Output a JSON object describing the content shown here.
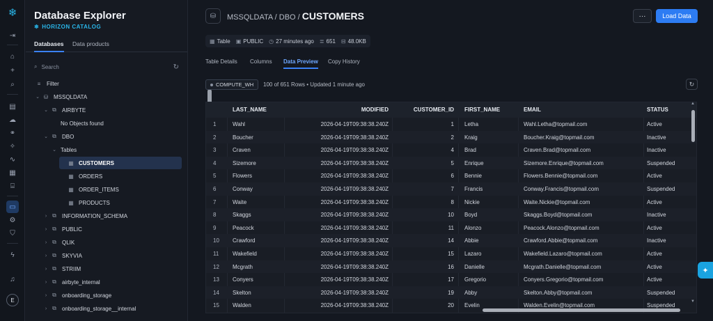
{
  "sidebar": {
    "title": "Database Explorer",
    "subtitle": "HORIZON CATALOG",
    "tabs": [
      "Databases",
      "Data products"
    ],
    "search_placeholder": "Search",
    "filter_label": "Filter",
    "tree": [
      {
        "label": "MSSQLDATA",
        "depth": 0,
        "icon": "database-icon",
        "expanded": true
      },
      {
        "label": "AIRBYTE",
        "depth": 1,
        "icon": "schema-icon",
        "expanded": true
      },
      {
        "label": "No Objects found",
        "depth": 2,
        "icon": "",
        "expanded": null
      },
      {
        "label": "DBO",
        "depth": 1,
        "icon": "schema-icon",
        "expanded": true
      },
      {
        "label": "Tables",
        "depth": 2,
        "icon": "",
        "expanded": true
      },
      {
        "label": "CUSTOMERS",
        "depth": 3,
        "icon": "table-icon",
        "expanded": null,
        "selected": true
      },
      {
        "label": "ORDERS",
        "depth": 3,
        "icon": "table-icon",
        "expanded": null
      },
      {
        "label": "ORDER_ITEMS",
        "depth": 3,
        "icon": "table-icon",
        "expanded": null
      },
      {
        "label": "PRODUCTS",
        "depth": 3,
        "icon": "table-icon",
        "expanded": null
      },
      {
        "label": "INFORMATION_SCHEMA",
        "depth": 1,
        "icon": "schema-icon",
        "expanded": false
      },
      {
        "label": "PUBLIC",
        "depth": 1,
        "icon": "schema-icon",
        "expanded": false
      },
      {
        "label": "QLIK",
        "depth": 1,
        "icon": "schema-icon",
        "expanded": false
      },
      {
        "label": "SKYVIA",
        "depth": 1,
        "icon": "schema-icon",
        "expanded": false
      },
      {
        "label": "STRIIM",
        "depth": 1,
        "icon": "schema-icon",
        "expanded": false
      },
      {
        "label": "airbyte_internal",
        "depth": 1,
        "icon": "schema-icon",
        "expanded": false
      },
      {
        "label": "onboarding_storage",
        "depth": 1,
        "icon": "schema-icon",
        "expanded": false
      },
      {
        "label": "onboarding_storage__internal",
        "depth": 1,
        "icon": "schema-icon",
        "expanded": false
      }
    ]
  },
  "rail": {
    "avatar_initial": "E"
  },
  "header": {
    "crumb_prefix": "MSSQLDATA / DBO /",
    "crumb_current": "CUSTOMERS",
    "more_label": "···",
    "load_label": "Load Data"
  },
  "meta": {
    "type": "Table",
    "schema": "PUBLIC",
    "modified": "27 minutes ago",
    "rows": "651",
    "size": "48.0KB"
  },
  "tabs": [
    "Table Details",
    "Columns",
    "Data Preview",
    "Copy History"
  ],
  "preview": {
    "warehouse": "COMPUTE_WH",
    "rows_info": "100 of 651 Rows • Updated 1 minute ago"
  },
  "table": {
    "columns": [
      "",
      "LAST_NAME",
      "MODIFIED",
      "CUSTOMER_ID",
      "FIRST_NAME",
      "EMAIL",
      "STATUS"
    ],
    "rows": [
      [
        "1",
        "Wahl",
        "2026-04-19T09:38:38.240Z",
        "1",
        "Letha",
        "Wahl.Letha@topmail.com",
        "Active"
      ],
      [
        "2",
        "Boucher",
        "2026-04-19T09:38:38.240Z",
        "2",
        "Kraig",
        "Boucher.Kraig@topmail.com",
        "Inactive"
      ],
      [
        "3",
        "Craven",
        "2026-04-19T09:38:38.240Z",
        "4",
        "Brad",
        "Craven.Brad@topmail.com",
        "Inactive"
      ],
      [
        "4",
        "Sizemore",
        "2026-04-19T09:38:38.240Z",
        "5",
        "Enrique",
        "Sizemore.Enrique@topmail.com",
        "Suspended"
      ],
      [
        "5",
        "Flowers",
        "2026-04-19T09:38:38.240Z",
        "6",
        "Bennie",
        "Flowers.Bennie@topmail.com",
        "Active"
      ],
      [
        "6",
        "Conway",
        "2026-04-19T09:38:38.240Z",
        "7",
        "Francis",
        "Conway.Francis@topmail.com",
        "Suspended"
      ],
      [
        "7",
        "Waite",
        "2026-04-19T09:38:38.240Z",
        "8",
        "Nickie",
        "Waite.Nickie@topmail.com",
        "Active"
      ],
      [
        "8",
        "Skaggs",
        "2026-04-19T09:38:38.240Z",
        "10",
        "Boyd",
        "Skaggs.Boyd@topmail.com",
        "Inactive"
      ],
      [
        "9",
        "Peacock",
        "2026-04-19T09:38:38.240Z",
        "11",
        "Alonzo",
        "Peacock.Alonzo@topmail.com",
        "Active"
      ],
      [
        "10",
        "Crawford",
        "2026-04-19T09:38:38.240Z",
        "14",
        "Abbie",
        "Crawford.Abbie@topmail.com",
        "Inactive"
      ],
      [
        "11",
        "Wakefield",
        "2026-04-19T09:38:38.240Z",
        "15",
        "Lazaro",
        "Wakefield.Lazaro@topmail.com",
        "Active"
      ],
      [
        "12",
        "Mcgrath",
        "2026-04-19T09:38:38.240Z",
        "16",
        "Danielle",
        "Mcgrath.Danielle@topmail.com",
        "Active"
      ],
      [
        "13",
        "Conyers",
        "2026-04-19T09:38:38.240Z",
        "17",
        "Gregorio",
        "Conyers.Gregorio@topmail.com",
        "Active"
      ],
      [
        "14",
        "Skelton",
        "2026-04-19T09:38:38.240Z",
        "19",
        "Abby",
        "Skelton.Abby@topmail.com",
        "Suspended"
      ],
      [
        "15",
        "Walden",
        "2026-04-19T09:38:38.240Z",
        "20",
        "Evelin",
        "Walden.Evelin@topmail.com",
        "Suspended"
      ]
    ]
  },
  "colors": {
    "accent": "#2d7cf3",
    "brand": "#29b5e8",
    "background": "#141820"
  }
}
